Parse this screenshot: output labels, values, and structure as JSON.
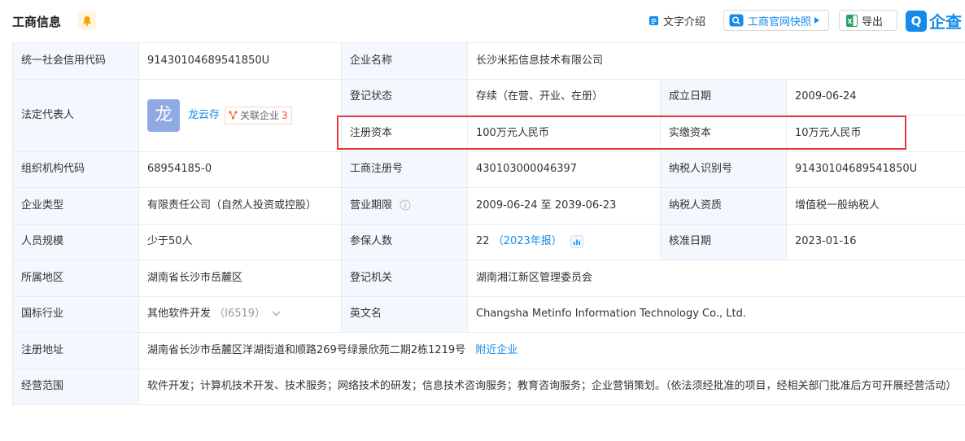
{
  "header": {
    "title": "工商信息",
    "text_intro": "文字介绍",
    "official_snapshot": "工商官网快照",
    "export": "导出",
    "brand_logo": "Q",
    "brand_name": "企查"
  },
  "rows": {
    "credit_code_label": "统一社会信用代码",
    "credit_code": "91430104689541850U",
    "company_name_label": "企业名称",
    "company_name": "长沙米拓信息技术有限公司",
    "legal_rep_label": "法定代表人",
    "legal_rep_avatar": "龙",
    "legal_rep_name": "龙云存",
    "related_label": "关联企业",
    "related_count": "3",
    "reg_status_label": "登记状态",
    "reg_status": "存续（在营、开业、在册）",
    "founded_label": "成立日期",
    "founded": "2009-06-24",
    "reg_capital_label": "注册资本",
    "reg_capital": "100万元人民币",
    "paid_capital_label": "实缴资本",
    "paid_capital": "10万元人民币",
    "org_code_label": "组织机构代码",
    "org_code": "68954185-0",
    "biz_reg_no_label": "工商注册号",
    "biz_reg_no": "430103000046397",
    "taxpayer_id_label": "纳税人识别号",
    "taxpayer_id": "91430104689541850U",
    "company_type_label": "企业类型",
    "company_type": "有限责任公司（自然人投资或控股）",
    "term_label": "营业期限",
    "term": "2009-06-24 至 2039-06-23",
    "taxpayer_qual_label": "纳税人资质",
    "taxpayer_qual": "增值税一般纳税人",
    "staff_size_label": "人员规模",
    "staff_size": "少于50人",
    "insured_label": "参保人数",
    "insured_count": "22",
    "insured_year": "（2023年报）",
    "approved_label": "核准日期",
    "approved": "2023-01-16",
    "region_label": "所属地区",
    "region": "湖南省长沙市岳麓区",
    "authority_label": "登记机关",
    "authority": "湖南湘江新区管理委员会",
    "industry_label": "国标行业",
    "industry": "其他软件开发",
    "industry_code": "（I6519）",
    "english_name_label": "英文名",
    "english_name": "Changsha Metinfo Information Technology Co., Ltd.",
    "address_label": "注册地址",
    "address": "湖南省长沙市岳麓区洋湖街道和顺路269号绿景欣苑二期2栋1219号",
    "nearby_link": "附近企业",
    "scope_label": "经营范围",
    "scope": "软件开发；计算机技术开发、技术服务；网络技术的研发；信息技术咨询服务；教育咨询服务；企业营销策划。（依法须经批准的项目，经相关部门批准后方可开展经营活动）"
  },
  "colors": {
    "accent": "#128bed",
    "label_bg": "#f2f8fe",
    "highlight_border": "#e8383d",
    "count_red": "#f04f2b"
  }
}
